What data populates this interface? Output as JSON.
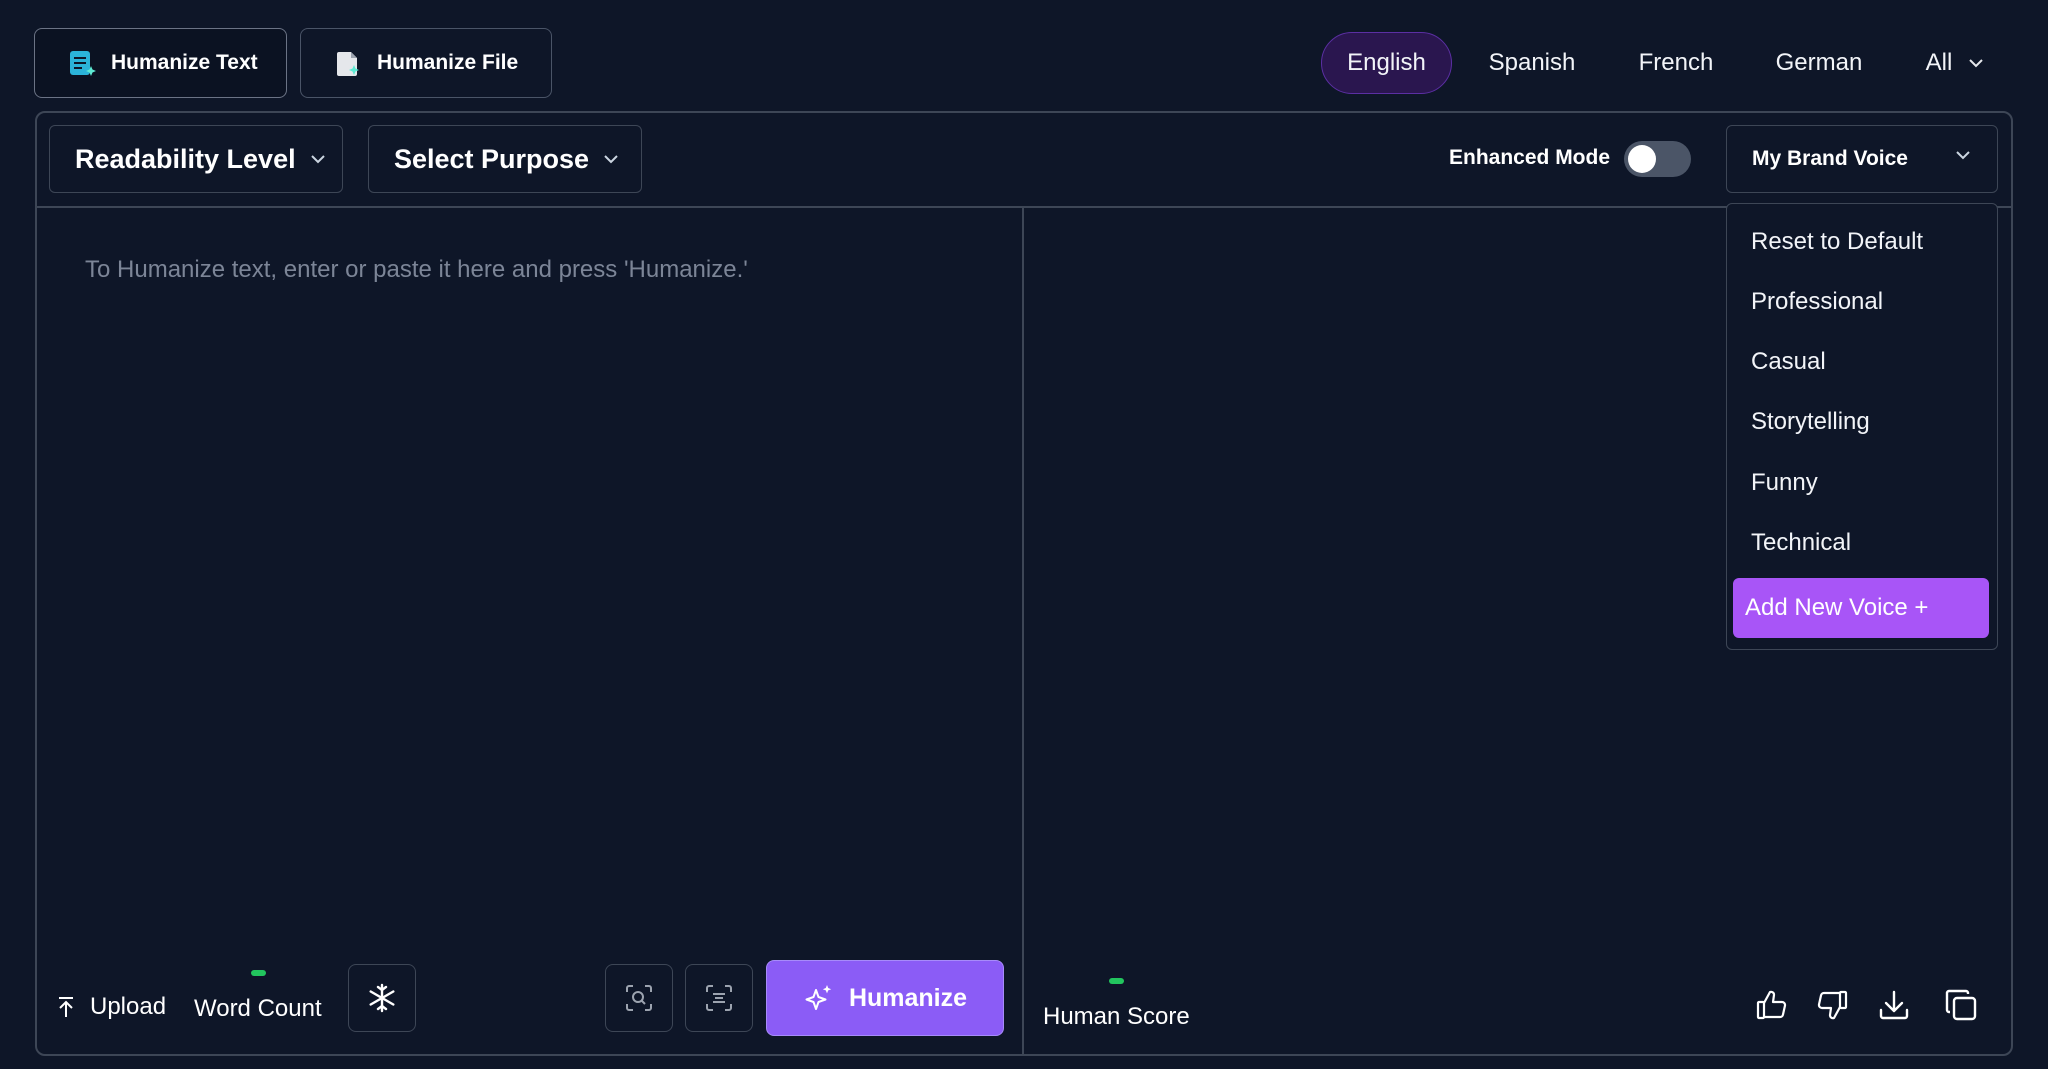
{
  "modes": {
    "humanize_text": "Humanize Text",
    "humanize_file": "Humanize File"
  },
  "languages": {
    "english": "English",
    "spanish": "Spanish",
    "french": "French",
    "german": "German",
    "all": "All"
  },
  "toolbar": {
    "readability": "Readability Level",
    "purpose": "Select Purpose",
    "enhanced_mode": "Enhanced Mode",
    "enhanced_mode_on": false,
    "brand_voice": "My Brand Voice"
  },
  "voice_menu": {
    "items": [
      "Reset to Default",
      "Professional",
      "Casual",
      "Storytelling",
      "Funny",
      "Technical"
    ],
    "add_new": "Add New Voice +"
  },
  "editor": {
    "placeholder": "To Humanize text, enter or paste it here and press 'Humanize.'"
  },
  "bottom_left": {
    "upload": "Upload",
    "word_count": "Word Count",
    "humanize": "Humanize"
  },
  "bottom_right": {
    "human_score": "Human Score"
  },
  "colors": {
    "background": "#0e1628",
    "accent": "#8b5cf6",
    "menu_highlight": "#a855f7",
    "active_language_bg": "#2a164f",
    "status_green": "#22c55e"
  },
  "icons": {
    "humanize_text": "document-text-icon",
    "humanize_file": "file-sparkle-icon",
    "upload": "upload-arrow-icon",
    "freeze": "snowflake-icon",
    "scan": "scan-search-icon",
    "align": "align-center-icon",
    "humanize": "sparkles-icon",
    "like": "thumbs-up-icon",
    "dislike": "thumbs-down-icon",
    "download": "download-icon",
    "copy": "copy-icon"
  }
}
